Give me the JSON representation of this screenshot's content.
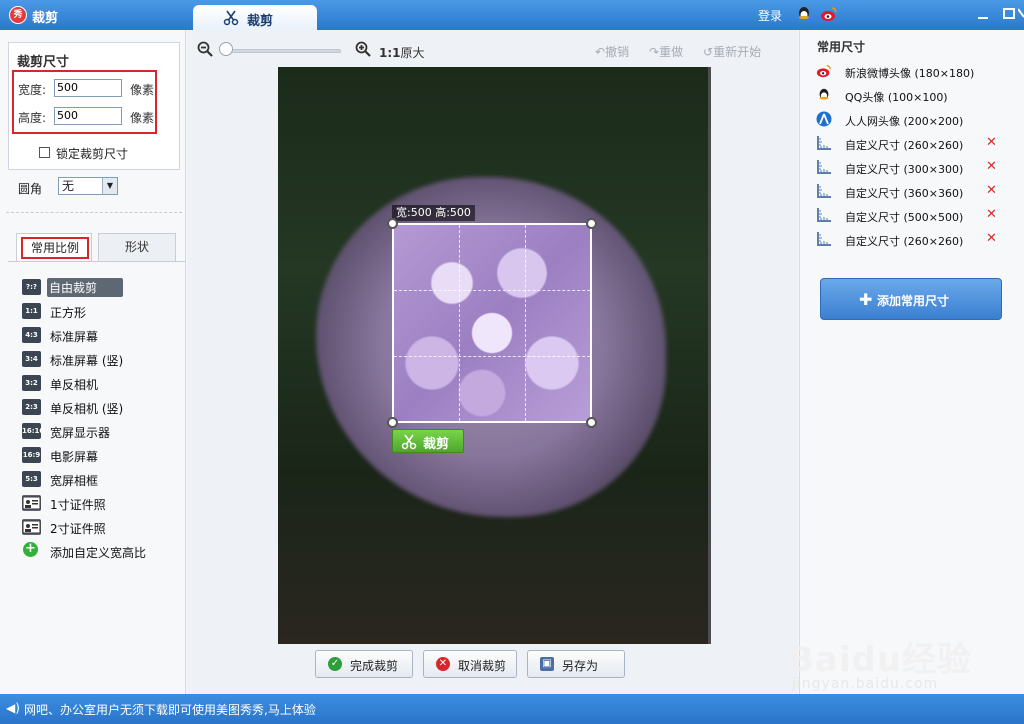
{
  "window": {
    "app_title": "裁剪",
    "tab_label": "裁剪",
    "login": "登录"
  },
  "crop_size": {
    "title": "裁剪尺寸",
    "width_label": "宽度:",
    "width_value": "500",
    "height_label": "高度:",
    "height_value": "500",
    "unit": "像素",
    "lock_label": "锁定裁剪尺寸",
    "corner_label": "圆角",
    "corner_value": "无"
  },
  "tabs": {
    "ratio": "常用比例",
    "shape": "形状"
  },
  "ratios": [
    {
      "badge": "?:?",
      "label": "自由裁剪",
      "selected": true
    },
    {
      "badge": "1:1",
      "label": "正方形"
    },
    {
      "badge": "4:3",
      "label": "标准屏幕"
    },
    {
      "badge": "3:4",
      "label": "标准屏幕 (竖)"
    },
    {
      "badge": "3:2",
      "label": "单反相机"
    },
    {
      "badge": "2:3",
      "label": "单反相机 (竖)"
    },
    {
      "badge": "16:10",
      "label": "宽屏显示器"
    },
    {
      "badge": "16:9",
      "label": "电影屏幕"
    },
    {
      "badge": "5:3",
      "label": "宽屏相框"
    },
    {
      "badge": "id",
      "label": "1寸证件照"
    },
    {
      "badge": "id",
      "label": "2寸证件照"
    },
    {
      "badge": "+",
      "label": "添加自定义宽高比"
    }
  ],
  "toolbar": {
    "zoom_ratio": "1:1",
    "zoom_label": "原大",
    "undo": "撤销",
    "redo": "重做",
    "reset": "重新开始"
  },
  "canvas": {
    "crop_info": "宽:500 高:500",
    "crop_button": "裁剪"
  },
  "bottom_buttons": {
    "done": "完成裁剪",
    "cancel": "取消裁剪",
    "save_as": "另存为"
  },
  "presets": {
    "title": "常用尺寸",
    "items": [
      {
        "icon": "weibo-icon",
        "label": "新浪微博头像 (180×180)",
        "deletable": false
      },
      {
        "icon": "qq-icon",
        "label": "QQ头像 (100×100)",
        "deletable": false
      },
      {
        "icon": "renren-icon",
        "label": "人人网头像 (200×200)",
        "deletable": false
      },
      {
        "icon": "ruler-icon",
        "label": "自定义尺寸 (260×260)",
        "deletable": true
      },
      {
        "icon": "ruler-icon",
        "label": "自定义尺寸 (300×300)",
        "deletable": true
      },
      {
        "icon": "ruler-icon",
        "label": "自定义尺寸 (360×360)",
        "deletable": true
      },
      {
        "icon": "ruler-icon",
        "label": "自定义尺寸 (500×500)",
        "deletable": true
      },
      {
        "icon": "ruler-icon",
        "label": "自定义尺寸 (260×260)",
        "deletable": true
      }
    ],
    "add_button": "添加常用尺寸",
    "delete_symbol": "✕"
  },
  "statusbar": {
    "text": "网吧、办公室用户无须下载即可使用美图秀秀,马上体验"
  },
  "watermark": {
    "logo": "Baidu经验",
    "site": "jingyan.baidu.com"
  },
  "colors": {
    "titlebar": "#2b78cc",
    "highlight_red": "#d9262c",
    "crop_green": "#4ea72c",
    "delete_red": "#e02828"
  }
}
